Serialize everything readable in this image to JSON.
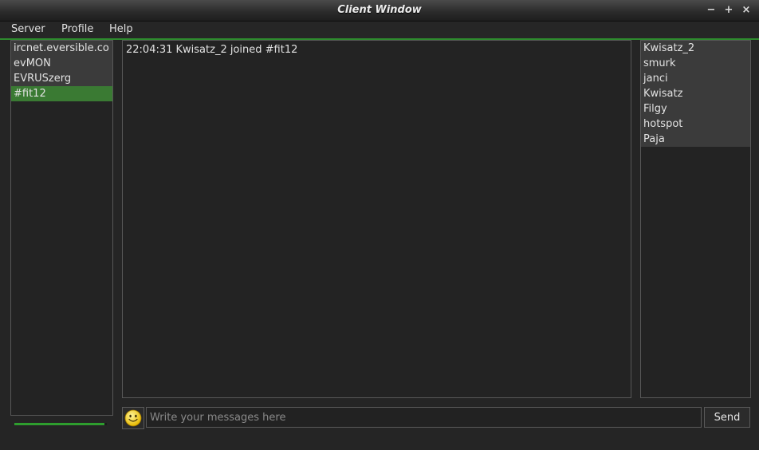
{
  "window": {
    "title": "Client Window"
  },
  "window_controls": {
    "minimize": "−",
    "maximize": "+",
    "close": "×"
  },
  "menu": [
    "Server",
    "Profile",
    "Help"
  ],
  "channels": [
    {
      "label": "ircnet.eversible.co",
      "selected": false
    },
    {
      "label": "evMON",
      "selected": false
    },
    {
      "label": "EVRUSzerg",
      "selected": false
    },
    {
      "label": "#fit12",
      "selected": true
    }
  ],
  "messages": [
    "22:04:31 Kwisatz_2 joined #fit12"
  ],
  "users": [
    "Kwisatz_2",
    "smurk",
    "janci",
    "Kwisatz",
    "Filgy",
    "hotspot",
    "Paja"
  ],
  "status": {
    "progress_fraction": 0.97
  },
  "composer": {
    "placeholder": "Write your messages here",
    "send_label": "Send",
    "emoji_icon": "smiley-icon"
  },
  "colors": {
    "accent": "#2e8b2e",
    "selected_item": "#3a7a33",
    "background": "#252525"
  }
}
